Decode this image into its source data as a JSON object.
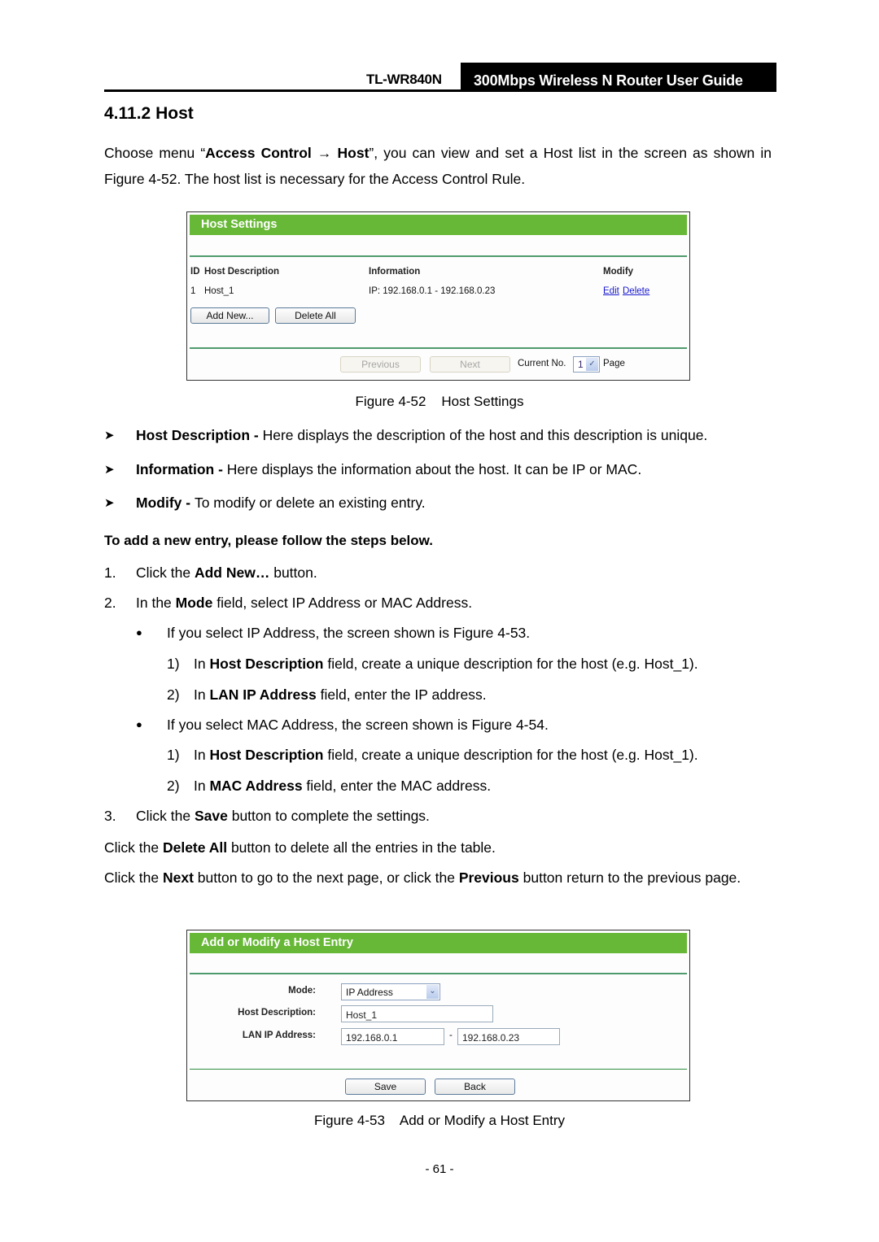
{
  "header": {
    "model": "TL-WR840N",
    "guide_title": "300Mbps Wireless N Router User Guide"
  },
  "section": {
    "number": "4.11.2",
    "title": "Host"
  },
  "intro": {
    "prefix": "Choose menu “",
    "menu_path_1": "Access Control",
    "arrow": "→",
    "menu_path_2": "Host",
    "suffix": "”, you can view and set a Host list in the screen as shown in Figure 4-52. The host list is necessary for the Access Control Rule."
  },
  "figure1": {
    "panel_title": "Host Settings",
    "columns": {
      "id": "ID",
      "description": "Host Description",
      "information": "Information",
      "modify": "Modify"
    },
    "rows": [
      {
        "id": "1",
        "description": "Host_1",
        "information": "IP: 192.168.0.1 - 192.168.0.23",
        "edit": "Edit",
        "delete": "Delete"
      }
    ],
    "add_new_label": "Add New...",
    "delete_all_label": "Delete All",
    "previous_label": "Previous",
    "next_label": "Next",
    "current_no_label": "Current No.",
    "page_value": "1",
    "page_label": "Page",
    "caption": "Figure 4-52    Host Settings"
  },
  "descriptions": [
    {
      "term": "Host Description - ",
      "text": "Here displays the description of the host and this description is unique."
    },
    {
      "term": "Information - ",
      "text": "Here displays the information about the host. It can be IP or MAC."
    },
    {
      "term": "Modify - ",
      "text": "To modify or delete an existing entry."
    }
  ],
  "steps_heading": "To add a new entry, please follow the steps below.",
  "steps": {
    "s1": {
      "num": "1.",
      "pre": "Click the ",
      "bold": "Add New…",
      "post": " button."
    },
    "s2": {
      "num": "2.",
      "pre": "In the ",
      "bold": "Mode",
      "post": " field, select IP Address or MAC Address."
    },
    "b1": {
      "bullet": "●",
      "text": "If you select IP Address, the screen shown is Figure 4-53."
    },
    "b1_1": {
      "num": "1)",
      "pre": "In ",
      "bold": "Host Description",
      "post": " field, create a unique description for the host (e.g. Host_1)."
    },
    "b1_2": {
      "num": "2)",
      "pre": "In ",
      "bold": "LAN IP Address",
      "post": " field, enter the IP address."
    },
    "b2": {
      "bullet": "●",
      "text": "If you select MAC Address, the screen shown is Figure 4-54."
    },
    "b2_1": {
      "num": "1)",
      "pre": "In ",
      "bold": "Host Description",
      "post": " field, create a unique description for the host (e.g. Host_1)."
    },
    "b2_2": {
      "num": "2)",
      "pre": "In ",
      "bold": "MAC Address",
      "post": " field, enter the MAC address."
    },
    "s3": {
      "num": "3.",
      "pre": "Click the ",
      "bold": "Save",
      "post": " button to complete the settings."
    }
  },
  "delete_all_note": {
    "pre": "Click the ",
    "bold": "Delete All",
    "post": " button to delete all the entries in the table."
  },
  "next_prev_note": {
    "pre": "Click the ",
    "bold1": "Next",
    "mid": " button to go to the next page, or click the ",
    "bold2": "Previous",
    "post": " button return to the previous page."
  },
  "figure2": {
    "panel_title": "Add or Modify a Host Entry",
    "mode_label": "Mode:",
    "mode_value": "IP Address",
    "host_desc_label": "Host Description:",
    "host_desc_value": "Host_1",
    "lan_ip_label": "LAN IP Address:",
    "lan_ip_start": "192.168.0.1",
    "range_sep": "-",
    "lan_ip_end": "192.168.0.23",
    "save_label": "Save",
    "back_label": "Back",
    "caption": "Figure 4-53    Add or Modify a Host Entry"
  },
  "page_number": "- 61 -",
  "colors": {
    "panel_header": "#67b836",
    "link": "#1a1ad0",
    "separator": "#4f9a6d"
  }
}
